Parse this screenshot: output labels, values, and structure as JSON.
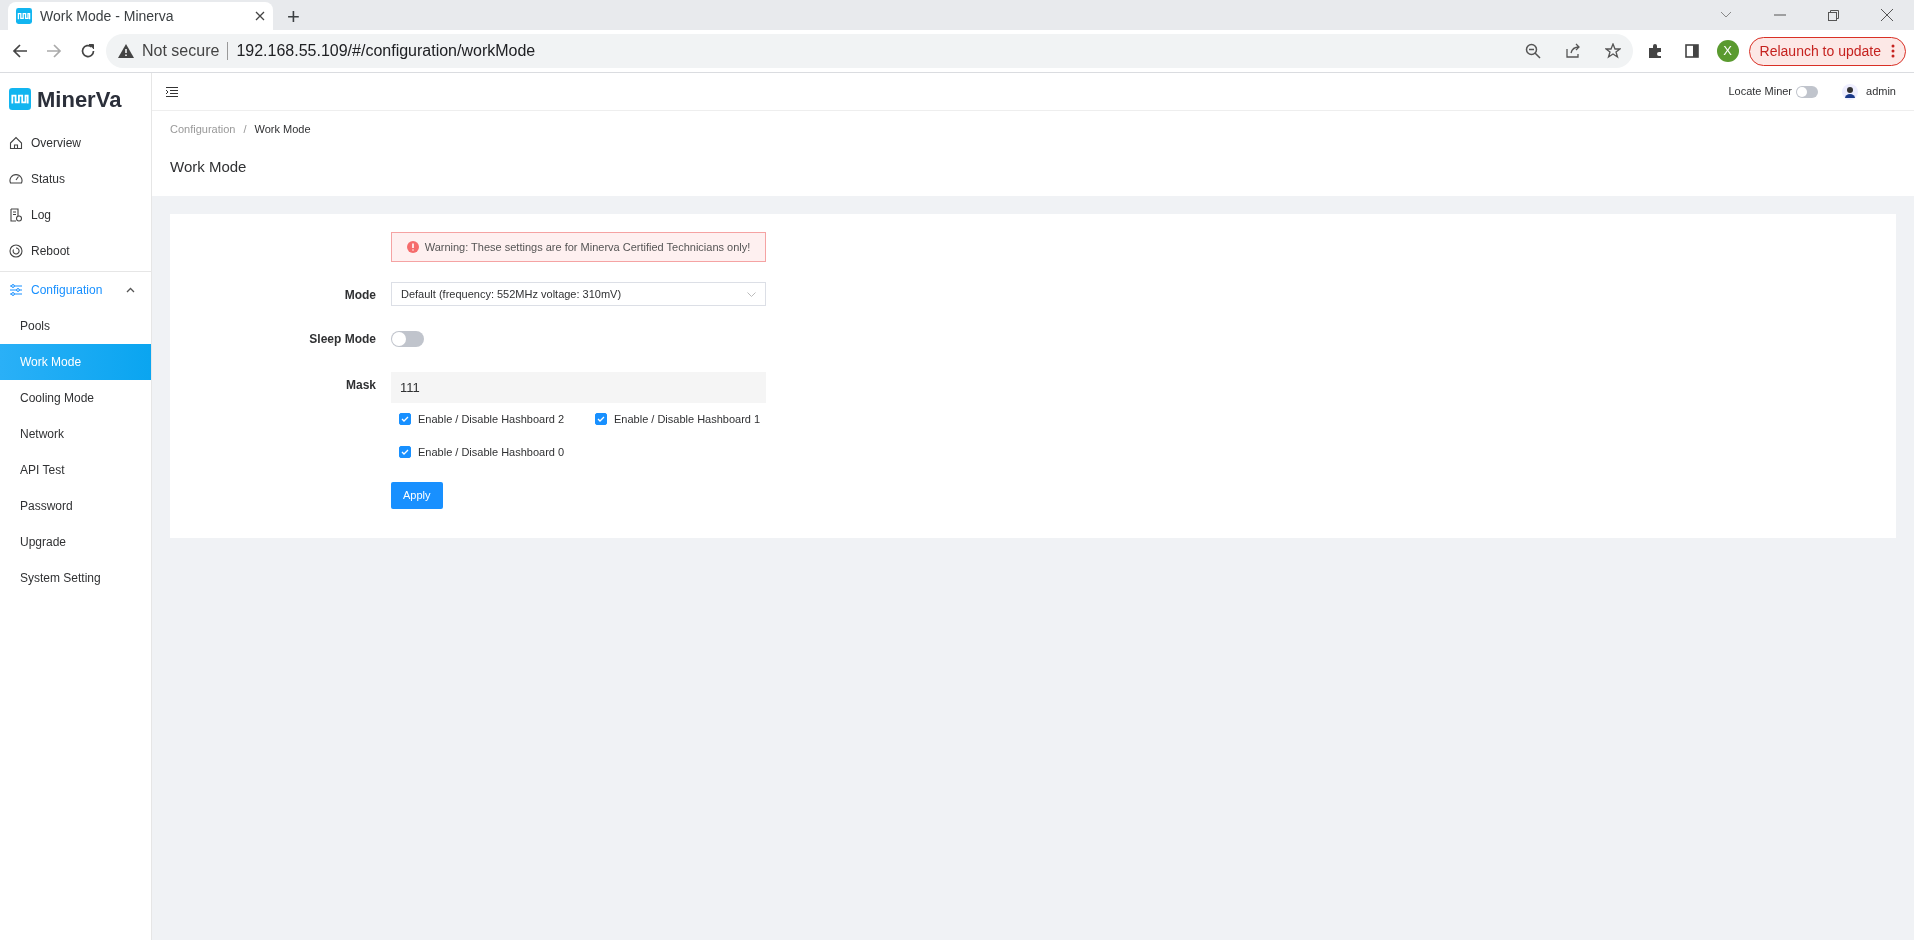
{
  "browser": {
    "tabs": [
      {
        "title": "Work Mode - Minerva",
        "selected": true
      }
    ],
    "new_tab": "+",
    "security": "Not secure",
    "address": "192.168.55.109/#/configuration/workMode",
    "profile_initial": "X",
    "relaunch": "Relaunch to update"
  },
  "app": {
    "logo": "MinerVa",
    "sidebar": [
      {
        "label": "Overview",
        "selected": false
      },
      {
        "label": "Status",
        "selected": false
      },
      {
        "label": "Log",
        "selected": false
      },
      {
        "label": "Reboot",
        "selected": false
      },
      {
        "label": "Configuration",
        "selected": true,
        "expanded": true,
        "children": [
          {
            "label": "Pools",
            "selected": false
          },
          {
            "label": "Work Mode",
            "selected": true
          },
          {
            "label": "Cooling Mode",
            "selected": false
          },
          {
            "label": "Network",
            "selected": false
          },
          {
            "label": "API Test",
            "selected": false
          },
          {
            "label": "Password",
            "selected": false
          },
          {
            "label": "Upgrade",
            "selected": false
          },
          {
            "label": "System Setting",
            "selected": false
          }
        ]
      }
    ],
    "header": {
      "locate_miner": {
        "label": "Locate Miner",
        "on": false
      },
      "user": "admin"
    },
    "breadcrumb_separator": "/",
    "breadcrumb": [
      {
        "label": "Configuration",
        "current": false
      },
      {
        "label": "Work Mode",
        "current": true
      }
    ],
    "page_title": "Work Mode",
    "form": {
      "warning": "Warning: These settings are for Minerva Certified Technicians only!",
      "mode": {
        "label": "Mode",
        "value": "Default (frequency: 552MHz voltage: 310mV)"
      },
      "sleep_mode": {
        "label": "Sleep Mode",
        "on": false
      },
      "mask": {
        "label": "Mask",
        "value": "111"
      },
      "hashboards": [
        {
          "label": "Enable / Disable Hashboard 2",
          "checked": true
        },
        {
          "label": "Enable / Disable Hashboard 1",
          "checked": true
        },
        {
          "label": "Enable / Disable Hashboard 0",
          "checked": true
        }
      ],
      "apply": "Apply"
    }
  }
}
